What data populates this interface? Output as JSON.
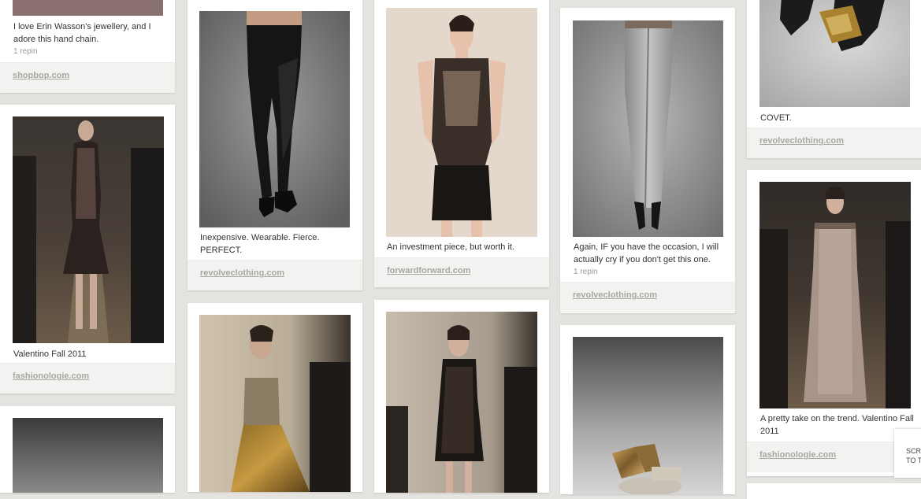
{
  "pins": [
    {
      "description": "I love Erin Wasson's jewellery, and I adore this hand chain.",
      "repins": "1 repin",
      "source": "shopbop.com"
    },
    {
      "description": "Valentino Fall 2011",
      "source": "fashionologie.com"
    },
    {
      "description": "Inexpensive. Wearable. Fierce. PERFECT.",
      "source": "revolveclothing.com"
    },
    {
      "description": "An investment piece, but worth it.",
      "source": "forwardforward.com"
    },
    {
      "description": "Again, IF you have the occasion, I will actually cry if you don't get this one.",
      "repins": "1 repin",
      "source": "revolveclothing.com"
    },
    {
      "description": "COVET.",
      "source": "revolveclothing.com"
    },
    {
      "description": "A pretty take on the trend. Valentino Fall 2011",
      "source": "fashionologie.com"
    }
  ],
  "images": [
    {
      "icon": "runway-model-lace-dress-photo"
    },
    {
      "icon": "black-leggings-photo"
    },
    {
      "icon": "sheer-black-dress-photo"
    },
    {
      "icon": "grey-draped-skirt-photo"
    },
    {
      "icon": "gold-ring-on-hand-photo"
    },
    {
      "icon": "runway-model-long-lace-gown-photo"
    },
    {
      "icon": "runway-model-gold-skirt-photo"
    },
    {
      "icon": "runway-model-black-lace-dress-photo"
    },
    {
      "icon": "gold-stone-ring-photo"
    },
    {
      "icon": "grey-product-photo"
    }
  ],
  "scroll_to_top": {
    "label_line1": "SCR",
    "label_line2": "TO T"
  }
}
